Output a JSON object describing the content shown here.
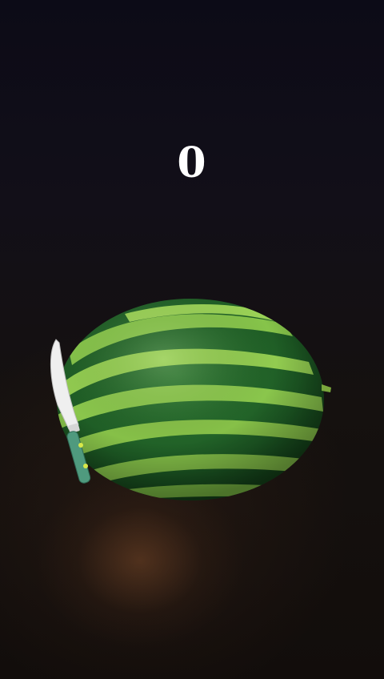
{
  "game": {
    "score": "0"
  },
  "colors": {
    "background": "#0e0c12",
    "melon_dark": "#1f5a26",
    "melon_light": "#8cc94a",
    "knife_blade": "#eeeeee",
    "knife_handle": "#4f9a7e",
    "score_text": "#ffffff"
  },
  "objects": {
    "fruit": "watermelon",
    "blade": "knife"
  }
}
